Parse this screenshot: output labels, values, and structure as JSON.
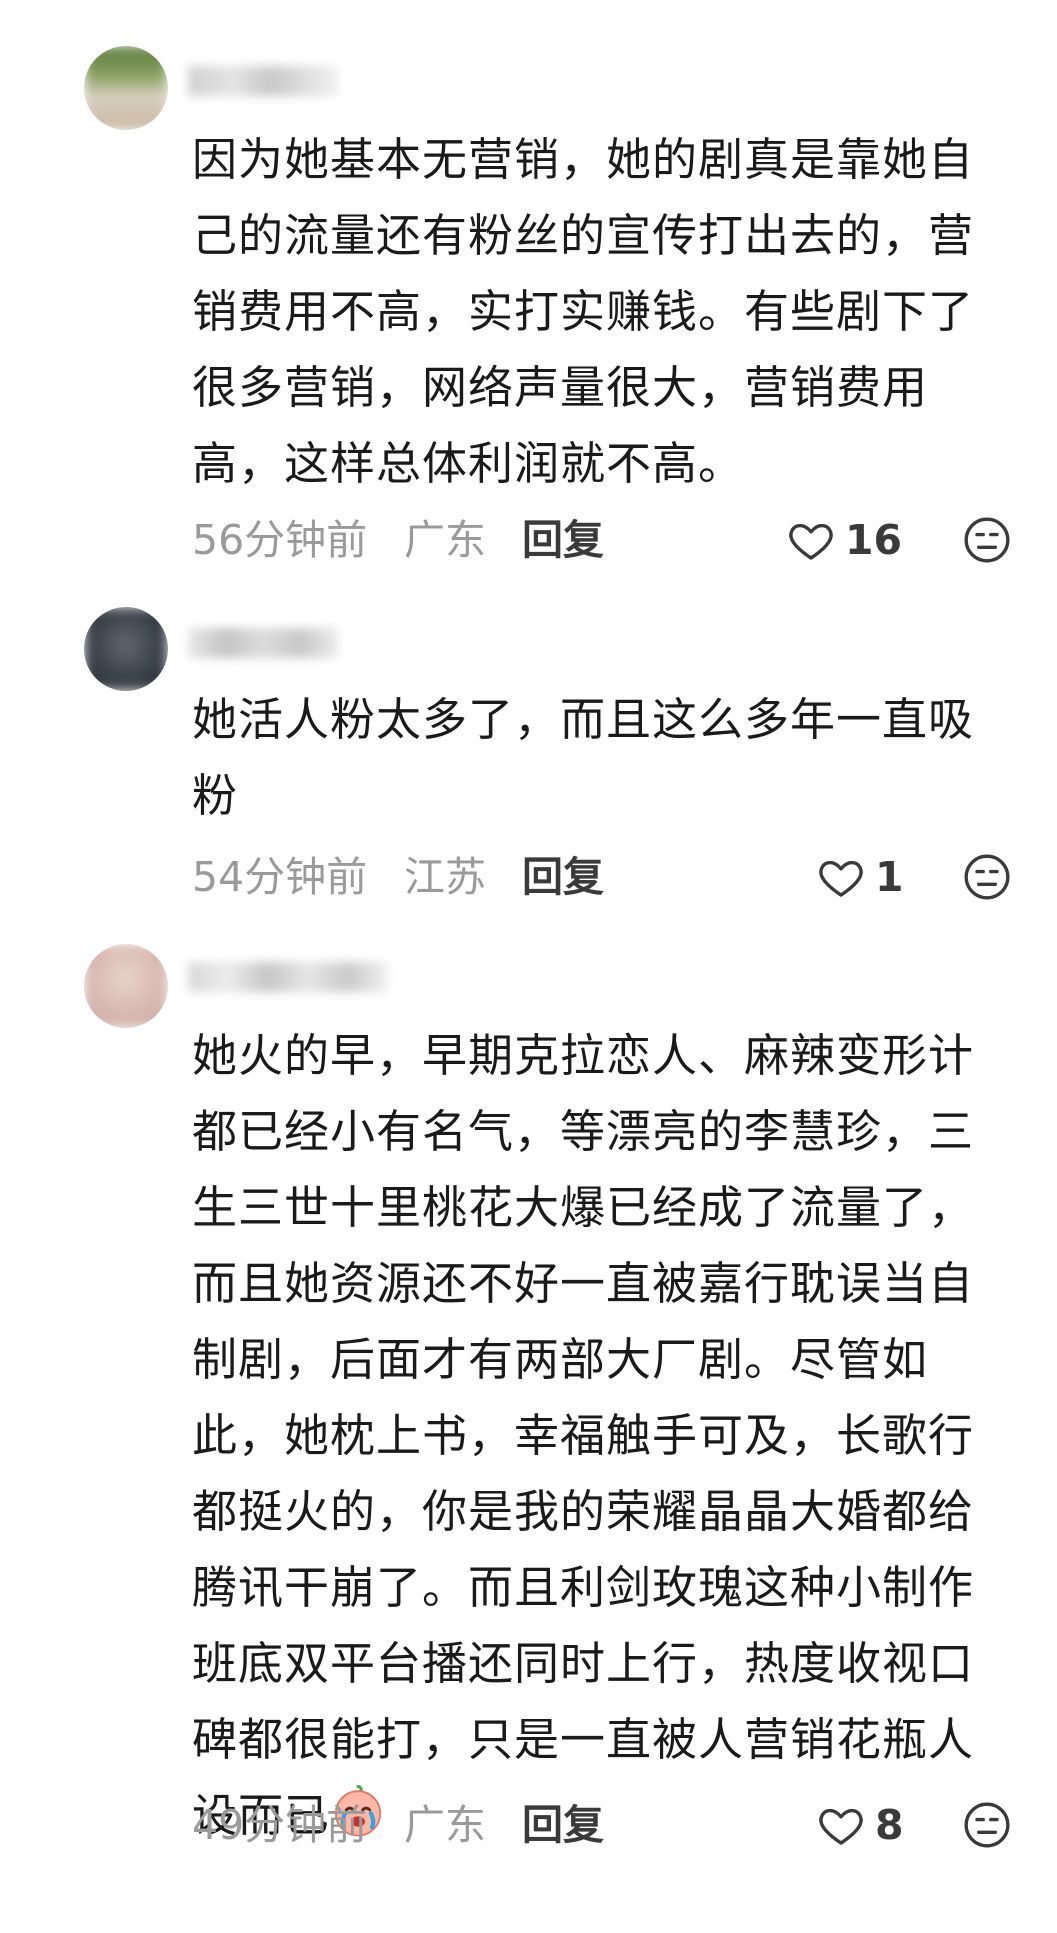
{
  "comments": [
    {
      "text": "因为她基本无营销，她的剧真是靠她自己的流量还有粉丝的宣传打出去的，营销费用不高，实打实赚钱。有些剧下了很多营销，网络声量很大，营销费用高，这样总体利润就不高。",
      "time": "56分钟前",
      "location": "广东",
      "reply_label": "回复",
      "likes": "16"
    },
    {
      "text": "她活人粉太多了，而且这么多年一直吸粉",
      "time": "54分钟前",
      "location": "江苏",
      "reply_label": "回复",
      "likes": "1"
    },
    {
      "text": "她火的早，早期克拉恋人、麻辣变形计都已经小有名气，等漂亮的李慧珍，三生三世十里桃花大爆已经成了流量了，而且她资源还不好一直被嘉行耽误当自制剧，后面才有两部大厂剧。尽管如此，她枕上书，幸福触手可及，长歌行都挺火的，你是我的荣耀晶晶大婚都给腾讯干崩了。而且利剑玫瑰这种小制作班底双平台播还同时上行，热度收视口碑都很能打，只是一直被人营销花瓶人设而已",
      "time": "49分钟前",
      "location": "广东",
      "reply_label": "回复",
      "likes": "8"
    }
  ],
  "icons": {
    "like": "heart-outline-icon",
    "dislike": "neutral-face-icon",
    "inline_emoji": "crying-face-emoji"
  }
}
